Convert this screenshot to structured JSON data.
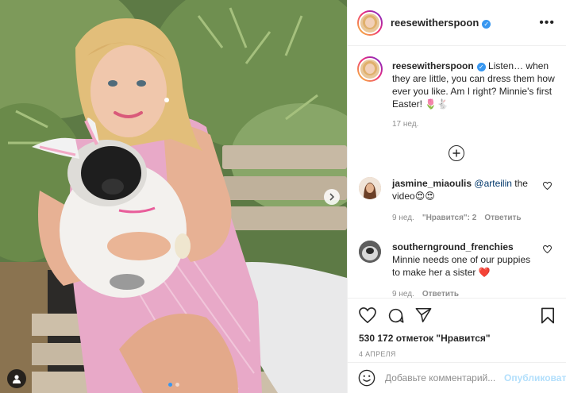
{
  "header": {
    "username": "reesewitherspoon",
    "more_label": "•••"
  },
  "caption": {
    "username": "reesewitherspoon",
    "text": "Listen… when they are little, you can dress them how ever you like. Am I right? Minnie's first Easter! 🌷🐇",
    "age": "17 нед."
  },
  "comments": [
    {
      "username": "jasmine_miaoulis",
      "mention": "@arteilin",
      "text": " the video😍😍",
      "age": "9 нед.",
      "likes": "\"Нравится\": 2",
      "reply": "Ответить"
    },
    {
      "username": "southernground_frenchies",
      "text": "Minnie needs one of our puppies to make her a sister ❤️",
      "age": "9 нед.",
      "reply": "Ответить"
    }
  ],
  "likes_count": "530 172 отметок \"Нравится\"",
  "post_date": "4 АПРЕЛЯ",
  "add_comment": {
    "placeholder": "Добавьте комментарий...",
    "post_label": "Опубликовать"
  },
  "carousel": {
    "slides": 2,
    "active": 1
  },
  "icons": [
    "verified-badge",
    "more-icon",
    "load-more-icon",
    "heart-icon",
    "comment-icon",
    "share-icon",
    "bookmark-icon",
    "emoji-icon",
    "next-arrow-icon",
    "user-tag-icon"
  ],
  "colors": {
    "accent": "#3897f0",
    "muted": "#8e8e8e",
    "text": "#262626",
    "post_disabled": "#b2dffc",
    "heart": "#ed4956"
  }
}
